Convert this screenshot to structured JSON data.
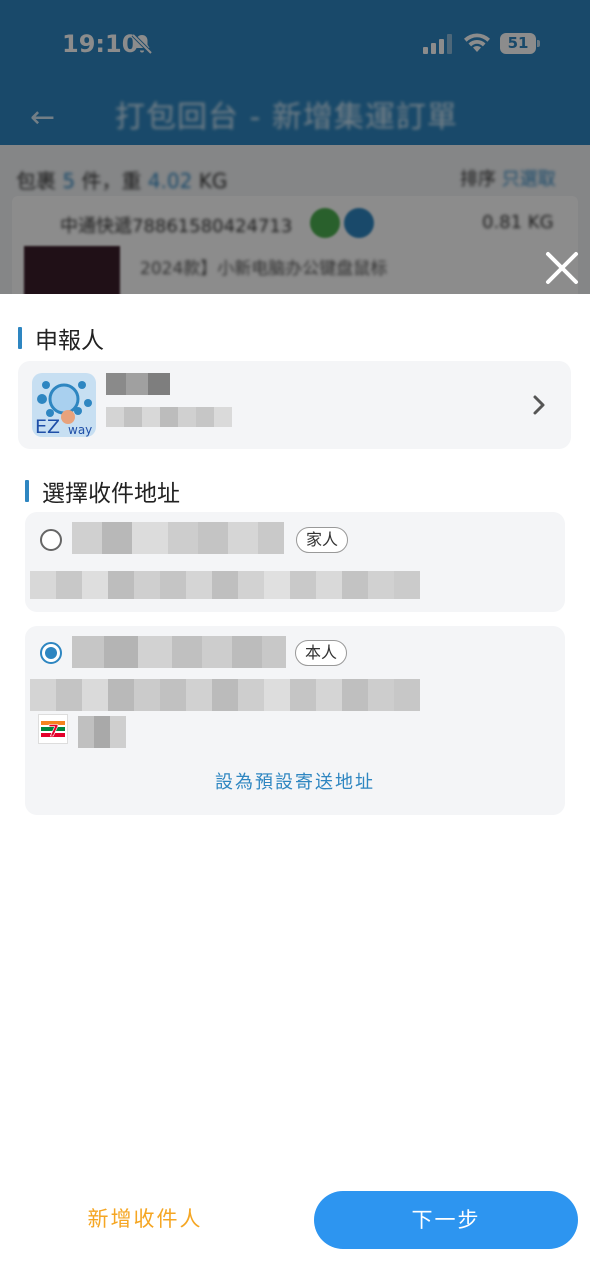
{
  "status_bar": {
    "time": "19:10",
    "battery": "51"
  },
  "background_page": {
    "title": "打包回台 - 新增集運訂單",
    "summary_prefix": "包裹",
    "summary_count": "5",
    "summary_mid": "件，重",
    "summary_weight": "4.02",
    "summary_unit": "KG",
    "sort_label": "排序",
    "sort_value": "只選取",
    "parcel_id": "中通快遞78861580424713",
    "parcel_weight": "0.81 KG",
    "item_text": "2024款】小新电脑办公键盘鼠标"
  },
  "declarant_section": {
    "title": "申報人"
  },
  "address_section": {
    "title": "選擇收件地址"
  },
  "addresses": [
    {
      "tag": "家人",
      "selected": false
    },
    {
      "tag": "本人",
      "selected": true,
      "set_default_label": "設為預設寄送地址"
    }
  ],
  "footer": {
    "add_recipient": "新增收件人",
    "next": "下一步"
  },
  "colors": {
    "accent": "#2e86c1",
    "primary_button": "#2d95f0",
    "secondary_text": "#f5a623"
  }
}
